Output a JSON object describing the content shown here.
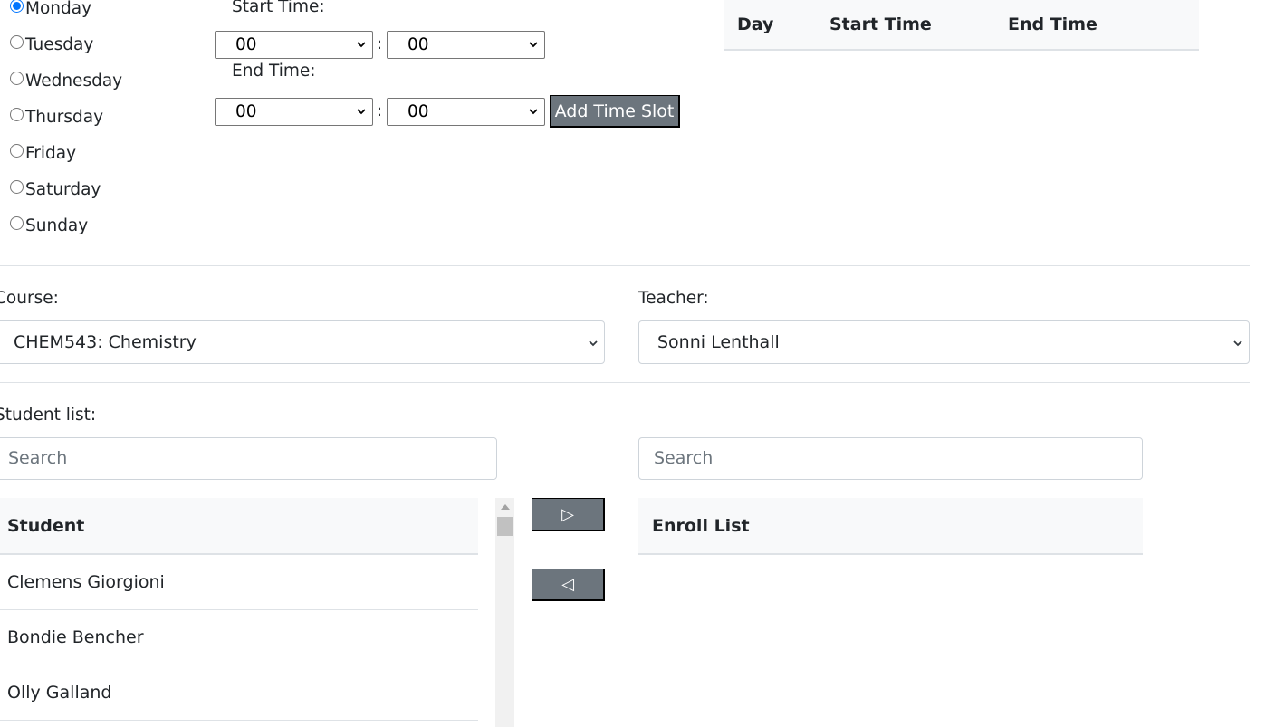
{
  "days": [
    {
      "label": "Monday",
      "checked": true
    },
    {
      "label": "Tuesday",
      "checked": false
    },
    {
      "label": "Wednesday",
      "checked": false
    },
    {
      "label": "Thursday",
      "checked": false
    },
    {
      "label": "Friday",
      "checked": false
    },
    {
      "label": "Saturday",
      "checked": false
    },
    {
      "label": "Sunday",
      "checked": false
    }
  ],
  "time_form": {
    "start_label": "Start Time:",
    "end_label": "End Time:",
    "start_hour": "00",
    "start_minute": "00",
    "end_hour": "00",
    "end_minute": "00",
    "separator": ":",
    "add_button": "Add Time Slot"
  },
  "slots_table": {
    "headers": [
      "Day",
      "Start Time",
      "End Time"
    ]
  },
  "course": {
    "label": "Course:",
    "value": "CHEM543: Chemistry"
  },
  "teacher": {
    "label": "Teacher:",
    "value": "Sonni Lenthall"
  },
  "students": {
    "label": "Student list:",
    "search_placeholder": "Search",
    "header": "Student",
    "rows": [
      "Clemens Giorgioni",
      "Bondie Bencher",
      "Olly Galland"
    ]
  },
  "transfer": {
    "add_icon": "▷",
    "remove_icon": "◁"
  },
  "enroll": {
    "search_placeholder": "Search",
    "header": "Enroll List"
  }
}
